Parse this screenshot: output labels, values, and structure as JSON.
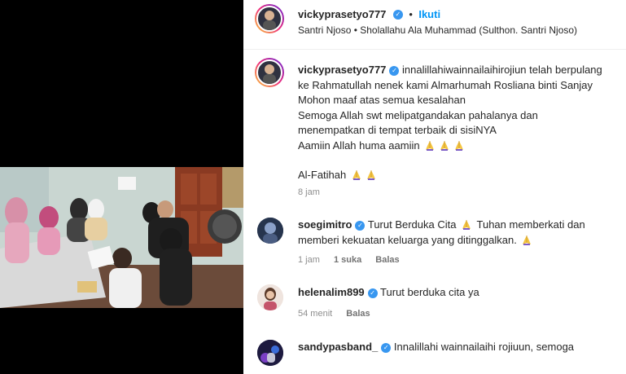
{
  "post": {
    "author": "vickyprasetyo777",
    "dot": "•",
    "follow_label": "Ikuti",
    "audio": "Santri Njoso • Sholallahu Ala Muhammad (Sulthon. Santri Njoso)"
  },
  "caption": {
    "author": "vickyprasetyo777",
    "line1": "innalillahiwainnailaihirojiun telah berpulang",
    "line2": "ke Rahmatullah nenek kami Almarhumah Rosliana binti Sanjay",
    "line3": "Mohon maaf atas semua kesalahan",
    "line4": "Semoga Allah swt melipatgandakan pahalanya dan",
    "line5": "menempatkan di tempat terbaik di sisiNYA",
    "line6": "Aamiin Allah huma aamiin",
    "line7": "Al-Fatihah",
    "time": "8 jam"
  },
  "comments": [
    {
      "user": "soegimitro",
      "text1": "Turut Berduka Cita",
      "text1b": "Tuhan memberkati dan",
      "text2": "memberi kekuatan keluarga yang ditinggalkan.",
      "time": "1 jam",
      "likes": "1 suka",
      "reply": "Balas"
    },
    {
      "user": "helenalim899",
      "text1": "Turut berduka cita ya",
      "time": "54 menit",
      "reply": "Balas"
    },
    {
      "user": "sandypasband_",
      "text1": "Innalillahi wainnailaihi rojiuun, semoga"
    }
  ],
  "colors": {
    "link": "#0095f6",
    "verified": "#3897f0",
    "muted": "#8e8e8e"
  }
}
